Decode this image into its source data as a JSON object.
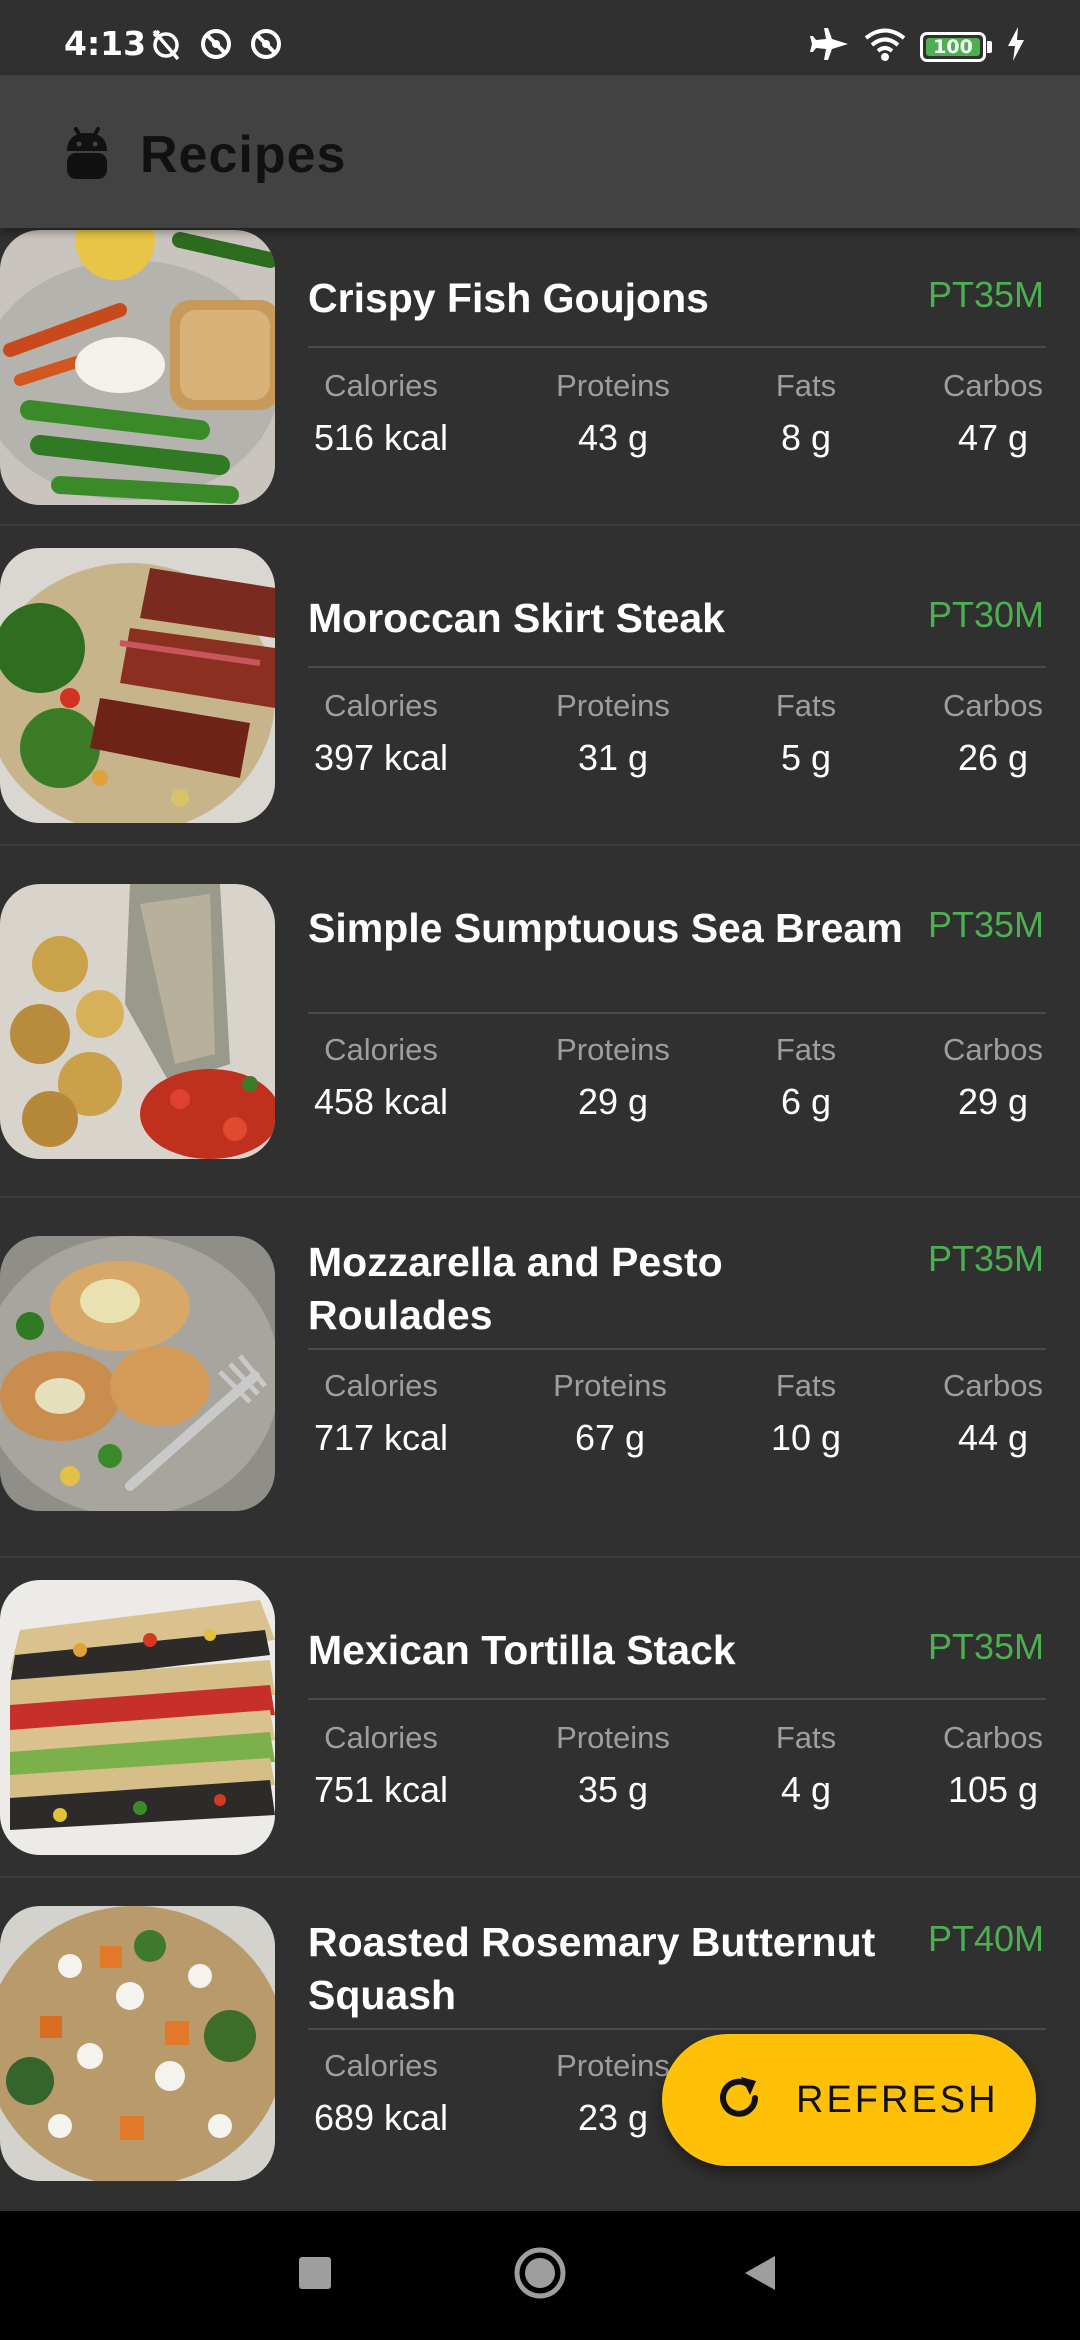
{
  "status_bar": {
    "time": "4:13",
    "battery_level": "100",
    "left_icons": [
      "alarm-off-icon",
      "do-not-disturb-icon",
      "do-not-disturb-icon"
    ],
    "right_icons": [
      "airplane-icon",
      "wifi-icon",
      "battery-icon",
      "charging-icon"
    ]
  },
  "app_bar": {
    "title": "Recipes",
    "logo_icon": "android-logo-icon"
  },
  "stat_labels": {
    "calories": "Calories",
    "proteins": "Proteins",
    "fats": "Fats",
    "carbos": "Carbos"
  },
  "recipes": [
    {
      "title": "Crispy Fish Goujons",
      "time": "PT35M",
      "calories": "516 kcal",
      "proteins": "43 g",
      "fats": "8 g",
      "carbos": "47 g"
    },
    {
      "title": "Moroccan Skirt Steak",
      "time": "PT30M",
      "calories": "397 kcal",
      "proteins": "31 g",
      "fats": "5 g",
      "carbos": "26 g"
    },
    {
      "title": "Simple Sumptuous Sea Bream",
      "time": "PT35M",
      "calories": "458 kcal",
      "proteins": "29 g",
      "fats": "6 g",
      "carbos": "29 g"
    },
    {
      "title": "Mozzarella and Pesto Roulades",
      "time": "PT35M",
      "calories": "717 kcal",
      "proteins": "67 g",
      "fats": "10 g",
      "carbos": "44 g"
    },
    {
      "title": "Mexican Tortilla Stack",
      "time": "PT35M",
      "calories": "751 kcal",
      "proteins": "35 g",
      "fats": "4 g",
      "carbos": "105 g"
    },
    {
      "title": "Roasted Rosemary Butternut Squash",
      "time": "PT40M",
      "calories": "689 kcal",
      "proteins": "23 g",
      "fats": "",
      "carbos": ""
    }
  ],
  "fab": {
    "label": "REFRESH",
    "icon": "refresh-icon",
    "color": "#ffc107"
  },
  "nav_bar": {
    "buttons": [
      "recents-square-icon",
      "home-circle-icon",
      "back-triangle-icon"
    ]
  },
  "colors": {
    "background": "#303030",
    "app_bar": "#424242",
    "accent_time": "#4caf50",
    "fab": "#ffc107"
  }
}
